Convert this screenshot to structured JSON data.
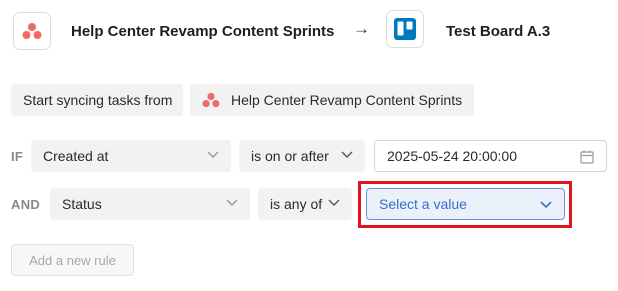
{
  "header": {
    "source_icon": "asana-logo-icon",
    "source_title": "Help Center Revamp Content Sprints",
    "arrow": "→",
    "target_icon": "trello-logo-icon",
    "target_title": "Test Board A.3"
  },
  "sync": {
    "label": "Start syncing tasks from",
    "project_icon": "asana-logo-icon",
    "project_name": "Help Center Revamp Content Sprints"
  },
  "rules": [
    {
      "keyword": "IF",
      "field": "Created at",
      "operator": "is on or after",
      "value": "2025-05-24 20:00:00",
      "value_icon": "calendar-icon"
    },
    {
      "keyword": "AND",
      "field": "Status",
      "operator": "is any of",
      "placeholder": "Select a value"
    }
  ],
  "actions": {
    "add_rule_label": "Add a new rule"
  },
  "colors": {
    "asana": "#f06a6a",
    "trello": "#0079bf",
    "highlight": "#e0141e",
    "value_text": "#3a6fc2"
  }
}
